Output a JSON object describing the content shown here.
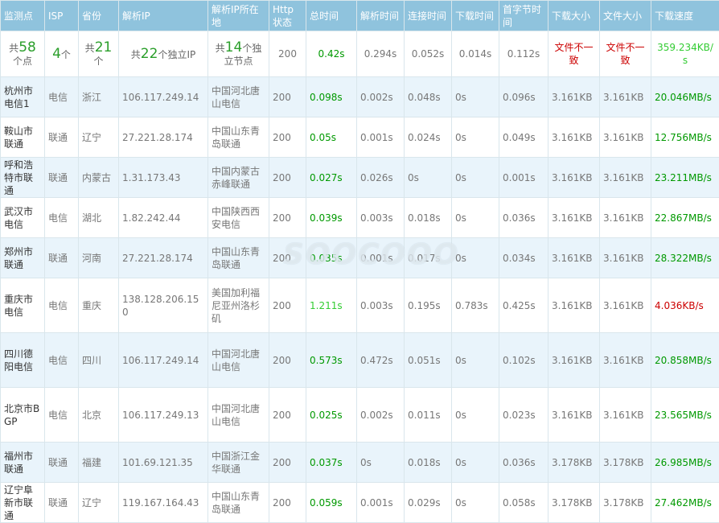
{
  "headers": [
    "监测点",
    "ISP",
    "省份",
    "解析IP",
    "解析IP所在地",
    "Http状态",
    "总时间",
    "解析时间",
    "连接时间",
    "下载时间",
    "首字节时间",
    "下载大小",
    "文件大小",
    "下载速度"
  ],
  "summary": {
    "points_pre": "共",
    "points_num": "58",
    "points_post": "个点",
    "isp_num": "4",
    "isp_post": "个",
    "prov_pre": "共",
    "prov_num": "21",
    "prov_post": "个",
    "ip_pre": "共",
    "ip_num": "22",
    "ip_post": "个独立IP",
    "loc_pre": "共",
    "loc_num": "14",
    "loc_post": "个独立节点",
    "http": "200",
    "total": "0.42s",
    "dns": "0.294s",
    "connect": "0.052s",
    "download": "0.014s",
    "first_byte": "0.112s",
    "dl_size": "文件不一致",
    "file_size": "文件不一致",
    "speed": "359.234KB/s"
  },
  "rows": [
    {
      "city": "杭州市电信1",
      "isp": "电信",
      "prov": "浙江",
      "ip": "106.117.249.14",
      "loc": "中国河北唐山电信",
      "http": "200",
      "total": "0.098s",
      "dns": "0.002s",
      "connect": "0.048s",
      "download": "0s",
      "first_byte": "0.096s",
      "dl_size": "3.161KB",
      "file_size": "3.161KB",
      "speed": "20.046MB/s"
    },
    {
      "city": "鞍山市联通",
      "isp": "联通",
      "prov": "辽宁",
      "ip": "27.221.28.174",
      "loc": "中国山东青岛联通",
      "http": "200",
      "total": "0.05s",
      "dns": "0.001s",
      "connect": "0.024s",
      "download": "0s",
      "first_byte": "0.049s",
      "dl_size": "3.161KB",
      "file_size": "3.161KB",
      "speed": "12.756MB/s"
    },
    {
      "city": "呼和浩特市联通",
      "isp": "联通",
      "prov": "内蒙古",
      "ip": "1.31.173.43",
      "loc": "中国内蒙古赤峰联通",
      "http": "200",
      "total": "0.027s",
      "dns": "0.026s",
      "connect": "0s",
      "download": "0s",
      "first_byte": "0.001s",
      "dl_size": "3.161KB",
      "file_size": "3.161KB",
      "speed": "23.211MB/s"
    },
    {
      "city": "武汉市电信",
      "isp": "电信",
      "prov": "湖北",
      "ip": "1.82.242.44",
      "loc": "中国陕西西安电信",
      "http": "200",
      "total": "0.039s",
      "dns": "0.003s",
      "connect": "0.018s",
      "download": "0s",
      "first_byte": "0.036s",
      "dl_size": "3.161KB",
      "file_size": "3.161KB",
      "speed": "22.867MB/s"
    },
    {
      "city": "郑州市联通",
      "isp": "联通",
      "prov": "河南",
      "ip": "27.221.28.174",
      "loc": "中国山东青岛联通",
      "http": "200",
      "total": "0.035s",
      "dns": "0.001s",
      "connect": "0.017s",
      "download": "0s",
      "first_byte": "0.034s",
      "dl_size": "3.161KB",
      "file_size": "3.161KB",
      "speed": "28.322MB/s"
    },
    {
      "city": "重庆市电信",
      "isp": "电信",
      "prov": "重庆",
      "ip": "138.128.206.150",
      "loc": "美国加利福尼亚州洛杉矶",
      "http": "200",
      "total": "1.211s",
      "dns": "0.003s",
      "connect": "0.195s",
      "download": "0.783s",
      "first_byte": "0.425s",
      "dl_size": "3.161KB",
      "file_size": "3.161KB",
      "speed": "4.036KB/s"
    },
    {
      "city": "四川德阳电信",
      "isp": "电信",
      "prov": "四川",
      "ip": "106.117.249.14",
      "loc": "中国河北唐山电信",
      "http": "200",
      "total": "0.573s",
      "dns": "0.472s",
      "connect": "0.051s",
      "download": "0s",
      "first_byte": "0.102s",
      "dl_size": "3.161KB",
      "file_size": "3.161KB",
      "speed": "20.858MB/s"
    },
    {
      "city": "北京市BGP",
      "isp": "电信",
      "prov": "北京",
      "ip": "106.117.249.13",
      "loc": "中国河北唐山电信",
      "http": "200",
      "total": "0.025s",
      "dns": "0.002s",
      "connect": "0.011s",
      "download": "0s",
      "first_byte": "0.023s",
      "dl_size": "3.161KB",
      "file_size": "3.161KB",
      "speed": "23.565MB/s"
    },
    {
      "city": "福州市联通",
      "isp": "联通",
      "prov": "福建",
      "ip": "101.69.121.35",
      "loc": "中国浙江金华联通",
      "http": "200",
      "total": "0.037s",
      "dns": "0s",
      "connect": "0.018s",
      "download": "0s",
      "first_byte": "0.036s",
      "dl_size": "3.178KB",
      "file_size": "3.178KB",
      "speed": "26.985MB/s"
    },
    {
      "city": "辽宁阜新市联通",
      "isp": "联通",
      "prov": "辽宁",
      "ip": "119.167.164.43",
      "loc": "中国山东青岛联通",
      "http": "200",
      "total": "0.059s",
      "dns": "0.001s",
      "connect": "0.029s",
      "download": "0s",
      "first_byte": "0.058s",
      "dl_size": "3.178KB",
      "file_size": "3.178KB",
      "speed": "27.462MB/s"
    }
  ],
  "watermark": "SOOCOOO"
}
